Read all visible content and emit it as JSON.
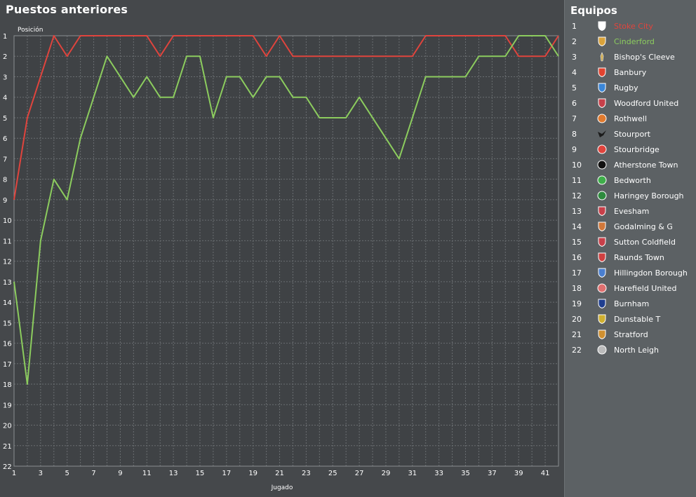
{
  "header": {
    "title": "Puestos anteriores"
  },
  "panel": {
    "title": "Equipos"
  },
  "colors": {
    "series_red": "#e0443d",
    "series_green": "#8ccc5e",
    "text": "#ffffff",
    "highlight_red": "#e0443d",
    "highlight_green": "#8ccc5e"
  },
  "teams": [
    {
      "pos": "1",
      "name": "Stoke City",
      "crest_icon": "shield-crest-icon",
      "crest_color": "#ffffff",
      "highlight": "red"
    },
    {
      "pos": "2",
      "name": "Cinderford",
      "crest_icon": "shield-crest-icon",
      "crest_color": "#d9a23a",
      "highlight": "green"
    },
    {
      "pos": "3",
      "name": "Bishop's Cleeve",
      "crest_icon": "torch-crest-icon",
      "crest_color": "#c9a64a",
      "highlight": ""
    },
    {
      "pos": "4",
      "name": "Banbury",
      "crest_icon": "shield-crest-icon",
      "crest_color": "#e2432f",
      "highlight": ""
    },
    {
      "pos": "5",
      "name": "Rugby",
      "crest_icon": "shield-crest-icon",
      "crest_color": "#3a86d8",
      "highlight": ""
    },
    {
      "pos": "6",
      "name": "Woodford United",
      "crest_icon": "shield-crest-icon",
      "crest_color": "#c8404a",
      "highlight": ""
    },
    {
      "pos": "7",
      "name": "Rothwell",
      "crest_icon": "round-crest-icon",
      "crest_color": "#e07a2e",
      "highlight": ""
    },
    {
      "pos": "8",
      "name": "Stourport",
      "crest_icon": "bird-crest-icon",
      "crest_color": "#1b1b1b",
      "highlight": ""
    },
    {
      "pos": "9",
      "name": "Stourbridge",
      "crest_icon": "round-crest-icon",
      "crest_color": "#e0443d",
      "highlight": ""
    },
    {
      "pos": "10",
      "name": "Atherstone Town",
      "crest_icon": "round-crest-icon",
      "crest_color": "#111111",
      "highlight": ""
    },
    {
      "pos": "11",
      "name": "Bedworth",
      "crest_icon": "round-crest-icon",
      "crest_color": "#3fae4a",
      "highlight": ""
    },
    {
      "pos": "12",
      "name": "Haringey Borough",
      "crest_icon": "round-crest-icon",
      "crest_color": "#2e8b3e",
      "highlight": ""
    },
    {
      "pos": "13",
      "name": "Evesham",
      "crest_icon": "shield-crest-icon",
      "crest_color": "#c8404a",
      "highlight": ""
    },
    {
      "pos": "14",
      "name": "Godalming & G",
      "crest_icon": "shield-crest-icon",
      "crest_color": "#d2783a",
      "highlight": ""
    },
    {
      "pos": "15",
      "name": "Sutton Coldfield",
      "crest_icon": "shield-crest-icon",
      "crest_color": "#c8404a",
      "highlight": ""
    },
    {
      "pos": "16",
      "name": "Raunds Town",
      "crest_icon": "shield-crest-icon",
      "crest_color": "#d04040",
      "highlight": ""
    },
    {
      "pos": "17",
      "name": "Hillingdon Borough",
      "crest_icon": "shield-crest-icon",
      "crest_color": "#4a7fd0",
      "highlight": ""
    },
    {
      "pos": "18",
      "name": "Harefield United",
      "crest_icon": "round-crest-icon",
      "crest_color": "#e07070",
      "highlight": ""
    },
    {
      "pos": "19",
      "name": "Burnham",
      "crest_icon": "shield-crest-icon",
      "crest_color": "#1f3e8f",
      "highlight": ""
    },
    {
      "pos": "20",
      "name": "Dunstable T",
      "crest_icon": "shield-crest-icon",
      "crest_color": "#d0b030",
      "highlight": ""
    },
    {
      "pos": "21",
      "name": "Stratford",
      "crest_icon": "shield-crest-icon",
      "crest_color": "#d09030",
      "highlight": ""
    },
    {
      "pos": "22",
      "name": "North Leigh",
      "crest_icon": "round-crest-icon",
      "crest_color": "#bbbbbb",
      "highlight": ""
    }
  ],
  "chart_data": {
    "type": "line",
    "xlabel": "Jugado",
    "ylabel": "Posición",
    "xlim": [
      1,
      42
    ],
    "ylim": [
      1,
      22
    ],
    "y_inverted": true,
    "x_ticks": [
      1,
      3,
      5,
      7,
      9,
      11,
      13,
      15,
      17,
      19,
      21,
      23,
      25,
      27,
      29,
      31,
      33,
      35,
      37,
      39,
      41
    ],
    "y_ticks": [
      1,
      2,
      3,
      4,
      5,
      6,
      7,
      8,
      9,
      10,
      11,
      12,
      13,
      14,
      15,
      16,
      17,
      18,
      19,
      20,
      21,
      22
    ],
    "grid": true,
    "series": [
      {
        "color": "#e0443d",
        "x": [
          1,
          2,
          3,
          4,
          5,
          6,
          7,
          8,
          9,
          10,
          11,
          12,
          13,
          14,
          15,
          16,
          17,
          18,
          19,
          20,
          21,
          22,
          23,
          24,
          25,
          26,
          27,
          28,
          29,
          30,
          31,
          32,
          33,
          34,
          35,
          36,
          37,
          38,
          39,
          40,
          41,
          42
        ],
        "values": [
          9,
          5,
          3,
          1,
          2,
          1,
          1,
          1,
          1,
          1,
          1,
          2,
          1,
          1,
          1,
          1,
          1,
          1,
          1,
          2,
          1,
          2,
          2,
          2,
          2,
          2,
          2,
          2,
          2,
          2,
          2,
          1,
          1,
          1,
          1,
          1,
          1,
          1,
          2,
          2,
          2,
          1
        ]
      },
      {
        "color": "#8ccc5e",
        "x": [
          1,
          2,
          3,
          4,
          5,
          6,
          7,
          8,
          9,
          10,
          11,
          12,
          13,
          14,
          15,
          16,
          17,
          18,
          19,
          20,
          21,
          22,
          23,
          24,
          25,
          26,
          27,
          28,
          29,
          30,
          31,
          32,
          33,
          34,
          35,
          36,
          37,
          38,
          39,
          40,
          41,
          42
        ],
        "values": [
          13,
          18,
          11,
          8,
          9,
          6,
          4,
          2,
          3,
          4,
          3,
          4,
          4,
          2,
          2,
          5,
          3,
          3,
          4,
          3,
          3,
          4,
          4,
          5,
          5,
          5,
          4,
          5,
          6,
          7,
          5,
          3,
          3,
          3,
          3,
          2,
          2,
          2,
          1,
          1,
          1,
          2
        ]
      }
    ]
  }
}
